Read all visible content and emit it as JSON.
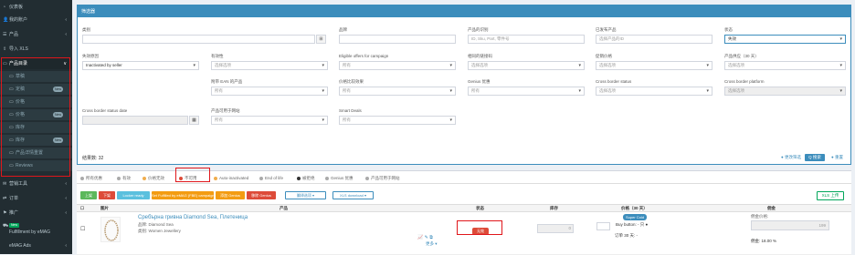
{
  "sidebar": {
    "items": [
      {
        "icon": "dashboard-icon",
        "glyph": "◔",
        "label": "仪表板"
      },
      {
        "icon": "users-icon",
        "glyph": "👤",
        "label": "我的账户",
        "chev": "‹"
      },
      {
        "icon": "list-icon",
        "glyph": "☰",
        "label": "产品",
        "chev": "‹"
      },
      {
        "icon": "upload-icon",
        "glyph": "⇪",
        "label": "导入 XLS"
      },
      {
        "icon": "folder-icon",
        "glyph": "▭",
        "label": "产品目录",
        "chev": "∨"
      }
    ],
    "subitems": [
      {
        "label": "草稿",
        "pill": ""
      },
      {
        "label": "定稿",
        "pill": "New"
      },
      {
        "label": "价格",
        "pill": ""
      },
      {
        "label": "价格",
        "pill": "New"
      },
      {
        "label": "库存",
        "pill": ""
      },
      {
        "label": "库存",
        "pill": "New"
      },
      {
        "label": "产品详情重置",
        "pill": ""
      },
      {
        "label": "Reviews",
        "pill": ""
      }
    ],
    "lower_items": [
      {
        "icon": "marketing-icon",
        "glyph": "✉",
        "label": "营销工具",
        "chev": "‹"
      },
      {
        "icon": "orders-icon",
        "glyph": "⇄",
        "label": "订单",
        "chev": "‹"
      },
      {
        "icon": "promotion-icon",
        "glyph": "⚑",
        "label": "推广",
        "chev": "‹"
      },
      {
        "icon": "fulfillment-icon",
        "glyph": "⛟",
        "label": "Fulfillment by eMAG",
        "badge": "New"
      },
      {
        "icon": "ads-icon",
        "glyph": "",
        "label": "eMAG Ads",
        "chev": "‹"
      }
    ]
  },
  "filter": {
    "title": "筛选器",
    "fields": {
      "category_label": "类别",
      "brand_label": "品牌",
      "product_id_label": "产品的识别",
      "product_id_placeholder": "ID, Sku, Part, 零件号",
      "linked_label": "已发布产品",
      "linked_placeholder": "选择产品的ID",
      "status_label": "状态",
      "status_value": "失效",
      "inactive_reason_label": "失效原因",
      "inactive_reason_value": "Inactivated by seller",
      "validity_label": "有效性",
      "validity_value": "选择选项",
      "eligible_label": "Eligible offers for campaign",
      "eligible_value": "所有",
      "related_label": "相同的链接码",
      "related_value": "选择选项",
      "offer_price_label": "促销价格",
      "offer_price_value": "选择选项",
      "stock30_label": "产品供应（30 天）",
      "stock30_value": "选择选项",
      "ean_label": "附带 EAN 的产品",
      "ean_value": "所有",
      "price_comp_label": "价格比较效果",
      "price_comp_value": "所有",
      "genius_label": "Genius 优惠",
      "genius_value": "所有",
      "cb_status_label": "Cross border status",
      "cb_status_value": "选择选项",
      "cb_platform_label": "Cross border platform",
      "cb_platform_value": "选择选项",
      "cb_date_label": "Cross border status date",
      "fulfil_label": "产品可用于网站",
      "fulfil_value": "所有",
      "smart_label": "Smart Deals",
      "smart_value": "所有"
    },
    "count_label": "结果数: 32",
    "advanced_link": "● 更改筛选",
    "search_btn": "Q 搜索",
    "reset_link": "● 重置"
  },
  "tabs": [
    {
      "label": "所有优惠",
      "color": "#aaa"
    },
    {
      "label": "有效",
      "color": "#aaa"
    },
    {
      "label": "价格无效",
      "color": "#f0ad4e"
    },
    {
      "label": "不可用",
      "color": "#dd4b39"
    },
    {
      "label": "Auto-inactivated",
      "color": "#f0ad4e"
    },
    {
      "label": "End of life",
      "color": "#aaa"
    },
    {
      "label": "被拒绝",
      "color": "#333"
    },
    {
      "label": "Genius 优惠",
      "color": "#aaa"
    },
    {
      "label": "产品可用于网站",
      "color": "#aaa"
    }
  ],
  "actions": [
    {
      "label": "上架",
      "color": "#5cb85c"
    },
    {
      "label": "下架",
      "color": "#dd4b39"
    },
    {
      "label": "Locker ready",
      "color": "#5bc0de"
    },
    {
      "label": "Set Fulfilled by eMAG (FBE) campaign",
      "color": "#f39c12"
    },
    {
      "label": "添加 Genius",
      "color": "#f39c12"
    },
    {
      "label": "移除 Genius",
      "color": "#dd4b39"
    },
    {
      "label": "翻译选项 ▾",
      "color": "outline"
    },
    {
      "label": "XLS download ▾",
      "color": "outline"
    }
  ],
  "xls_btn": "XLS 上传",
  "table": {
    "headers": [
      "图片",
      "产品",
      "状态",
      "库存",
      "价格（30 天）",
      "佣金"
    ],
    "row": {
      "name": "Сребърна гривна Diamond Sea, Плетеница",
      "brand": "品牌: Diamond Sea",
      "category": "类别: Women Jewellery",
      "more": "更多 ▾",
      "status": "无效",
      "stock": "0",
      "supercold": "Super Cold",
      "buy_button": "Buy button: - 只 ●",
      "offers": "订单 30 天: -",
      "commission_label": "佣金价格:",
      "commission_value": "199",
      "commission_extra": "佣金: 18.00 %"
    }
  }
}
